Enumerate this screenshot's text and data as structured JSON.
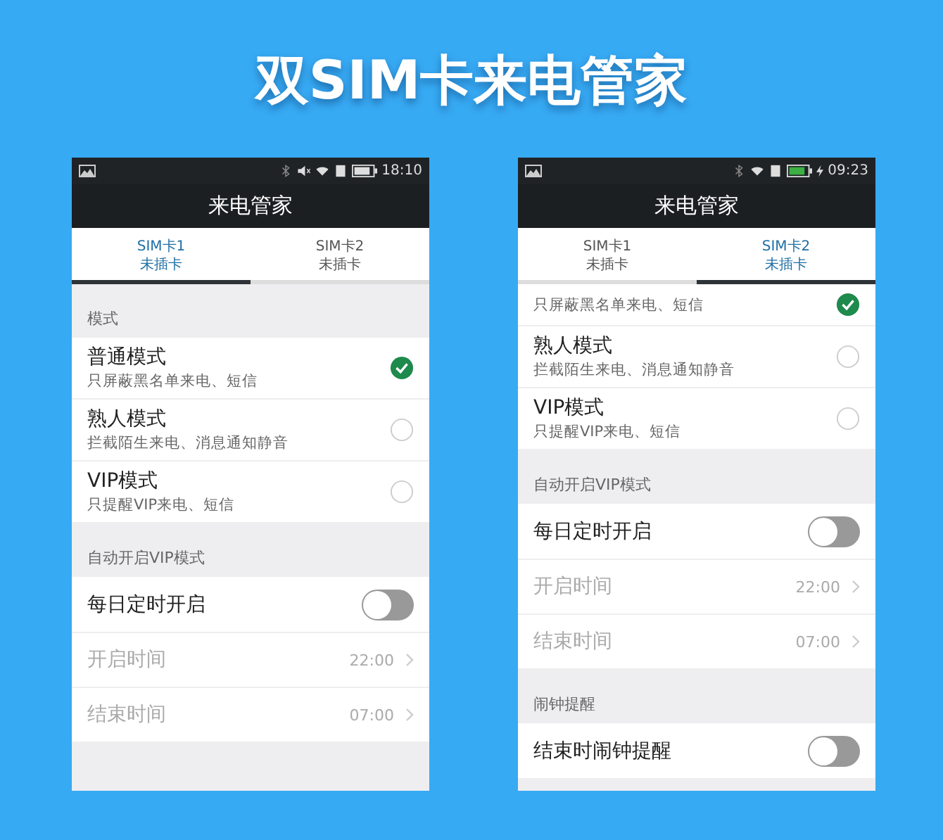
{
  "headline": "双SIM卡来电管家",
  "phones": [
    {
      "status": {
        "time": "18:10",
        "muted": true,
        "charging": false
      },
      "title": "来电管家",
      "tabs": [
        {
          "name": "SIM卡1",
          "state": "未插卡",
          "selected": true
        },
        {
          "name": "SIM卡2",
          "state": "未插卡",
          "selected": false
        }
      ],
      "sections": [
        {
          "header": "模式",
          "items": [
            {
              "kind": "radio",
              "title": "普通模式",
              "subtitle": "只屏蔽黑名单来电、短信",
              "selected": true
            },
            {
              "kind": "radio",
              "title": "熟人模式",
              "subtitle": "拦截陌生来电、消息通知静音",
              "selected": false
            },
            {
              "kind": "radio",
              "title": "VIP模式",
              "subtitle": "只提醒VIP来电、短信",
              "selected": false
            }
          ]
        },
        {
          "header": "自动开启VIP模式",
          "items": [
            {
              "kind": "toggle",
              "label": "每日定时开启",
              "on": false
            },
            {
              "kind": "time",
              "label": "开启时间",
              "value": "22:00",
              "disabled": true
            },
            {
              "kind": "time",
              "label": "结束时间",
              "value": "07:00",
              "disabled": true
            }
          ]
        }
      ]
    },
    {
      "status": {
        "time": "09:23",
        "muted": false,
        "charging": true
      },
      "title": "来电管家",
      "tabs": [
        {
          "name": "SIM卡1",
          "state": "未插卡",
          "selected": false
        },
        {
          "name": "SIM卡2",
          "state": "未插卡",
          "selected": true
        }
      ],
      "sections": [
        {
          "items": [
            {
              "kind": "radio",
              "subtitle": "只屏蔽黑名单来电、短信",
              "selected": true
            },
            {
              "kind": "radio",
              "title": "熟人模式",
              "subtitle": "拦截陌生来电、消息通知静音",
              "selected": false
            },
            {
              "kind": "radio",
              "title": "VIP模式",
              "subtitle": "只提醒VIP来电、短信",
              "selected": false
            }
          ]
        },
        {
          "header": "自动开启VIP模式",
          "items": [
            {
              "kind": "toggle",
              "label": "每日定时开启",
              "on": false
            },
            {
              "kind": "time",
              "label": "开启时间",
              "value": "22:00",
              "disabled": true
            },
            {
              "kind": "time",
              "label": "结束时间",
              "value": "07:00",
              "disabled": true
            }
          ]
        },
        {
          "header": "闹钟提醒",
          "items": [
            {
              "kind": "toggle",
              "label": "结束时闹钟提醒",
              "on": false
            }
          ]
        }
      ]
    }
  ]
}
